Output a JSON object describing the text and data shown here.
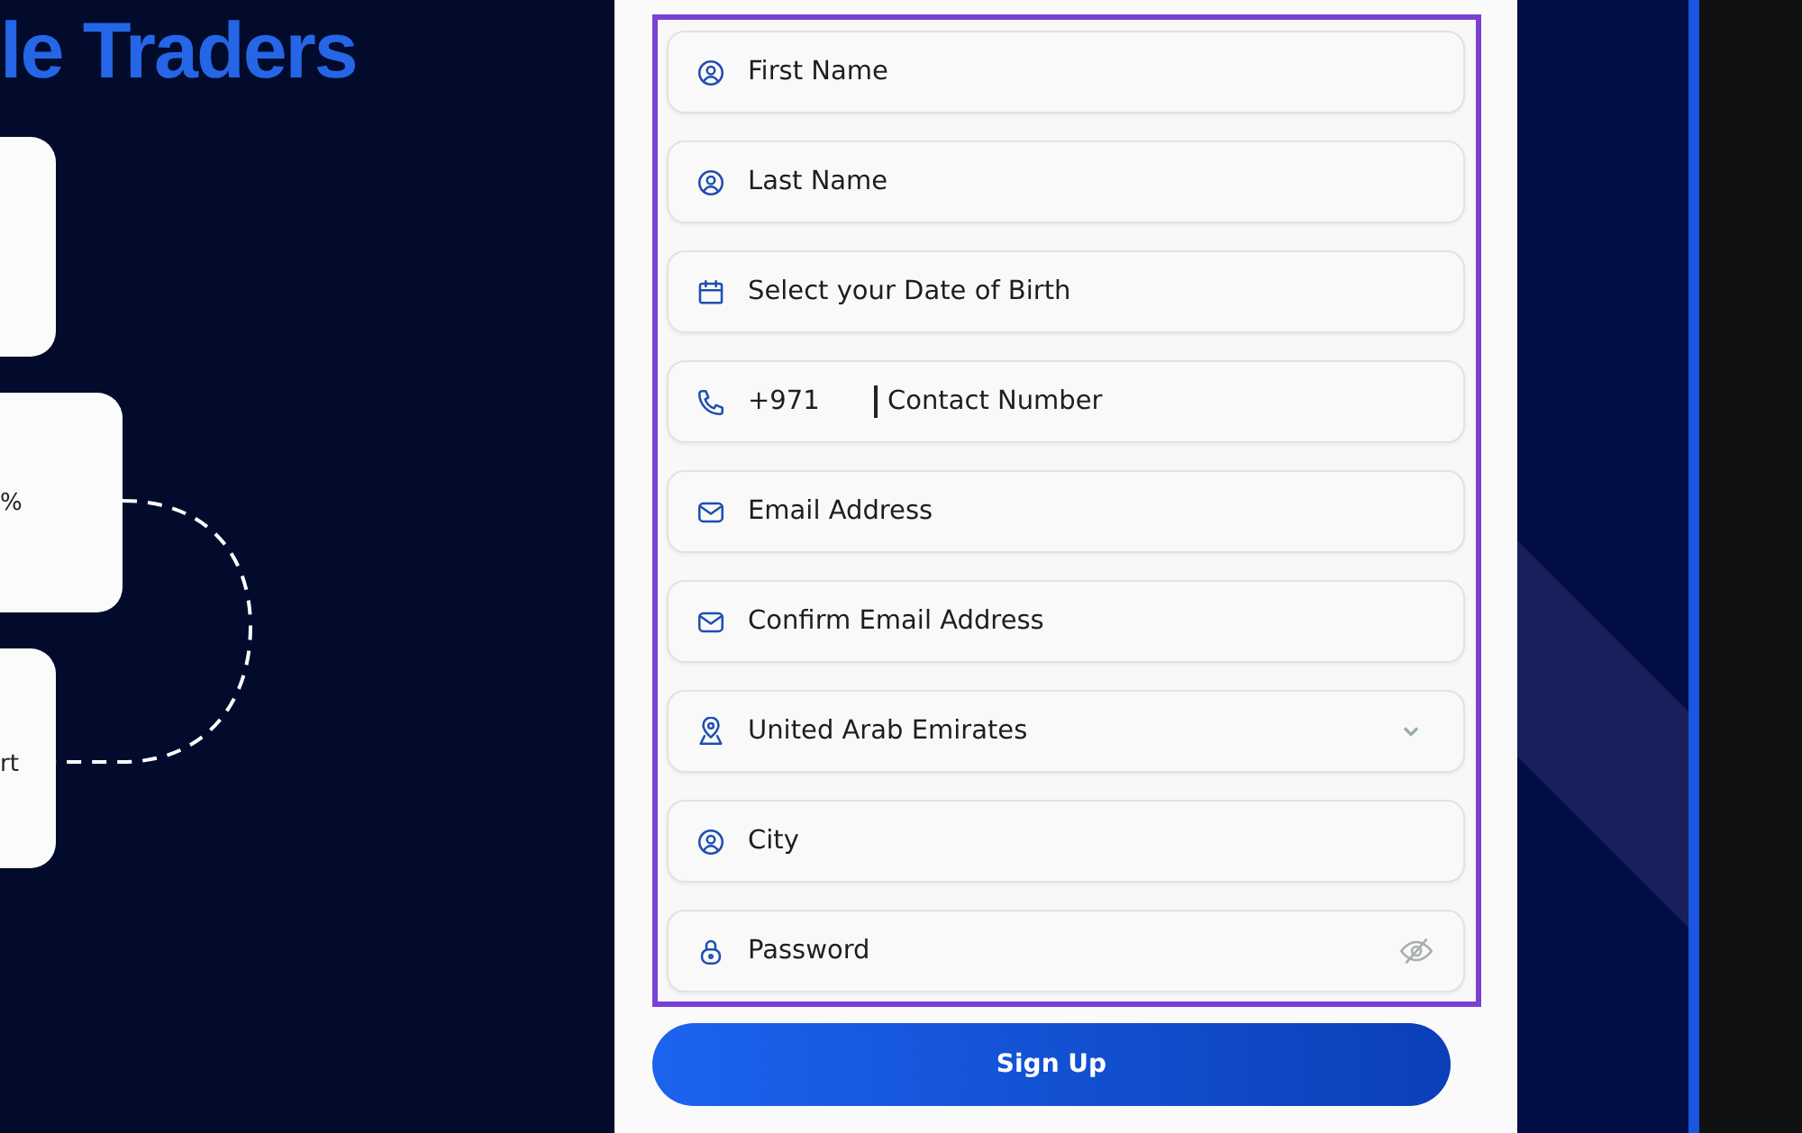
{
  "hero": {
    "heading": "le Traders"
  },
  "cards": [
    {
      "kind": "blank"
    },
    {
      "kind": "labeled",
      "text": "%"
    },
    {
      "kind": "labeled",
      "text": "rt"
    }
  ],
  "form": {
    "fields": [
      {
        "kind": "name",
        "placeholder": "First Name"
      },
      {
        "kind": "name",
        "placeholder": "Last Name"
      },
      {
        "kind": "date",
        "placeholder": "Select your Date of Birth"
      },
      {
        "kind": "phone",
        "prefix": "+971",
        "placeholder": "Contact Number"
      },
      {
        "kind": "email",
        "placeholder": "Email Address"
      },
      {
        "kind": "email",
        "placeholder": "Confirm Email Address"
      },
      {
        "kind": "country",
        "value": "United Arab Emirates"
      },
      {
        "kind": "city",
        "placeholder": "City"
      },
      {
        "kind": "password",
        "placeholder": "Password"
      }
    ],
    "submit": "Sign Up"
  }
}
